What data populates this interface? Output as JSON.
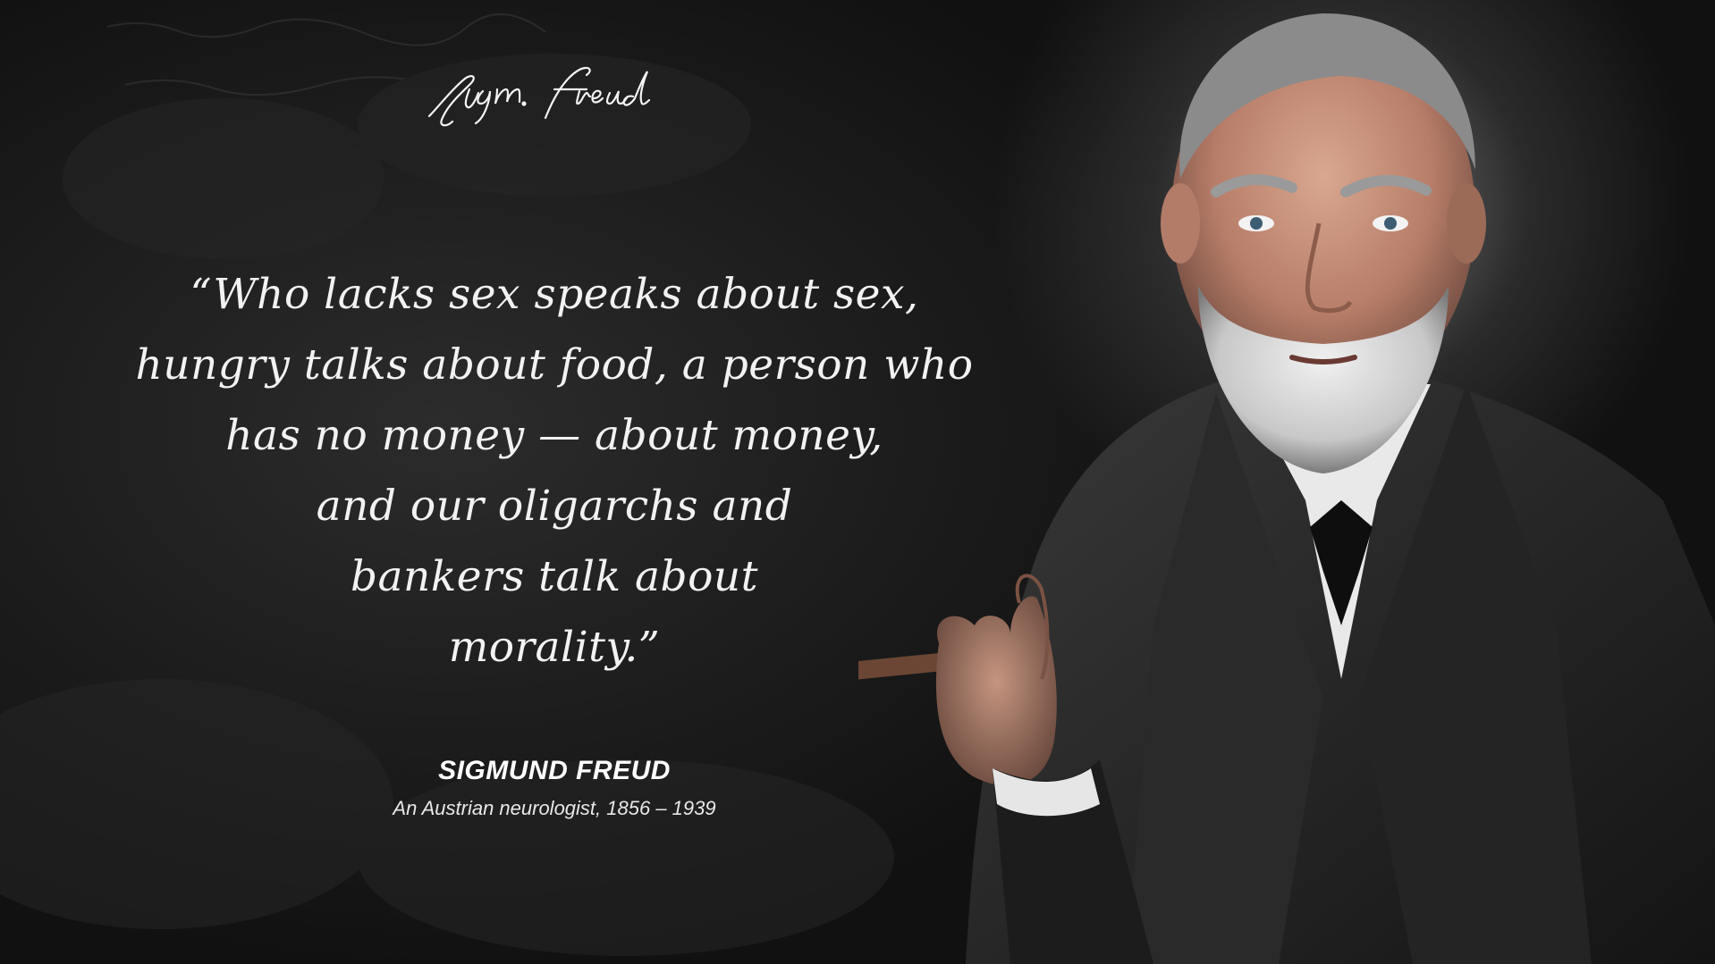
{
  "quote": {
    "text": "“Who lacks sex speaks about sex,\nhungry talks about food, a person who\nhas no money — about money,\nand our oligarchs and\nbankers talk about\nmorality.”"
  },
  "author": {
    "name": "SIGMUND FREUD",
    "description": "An Austrian neurologist, 1856 – 1939"
  },
  "signature": {
    "text": "Sigm. Freud"
  },
  "colors": {
    "background": "#161616",
    "text": "#f2f2f2"
  }
}
